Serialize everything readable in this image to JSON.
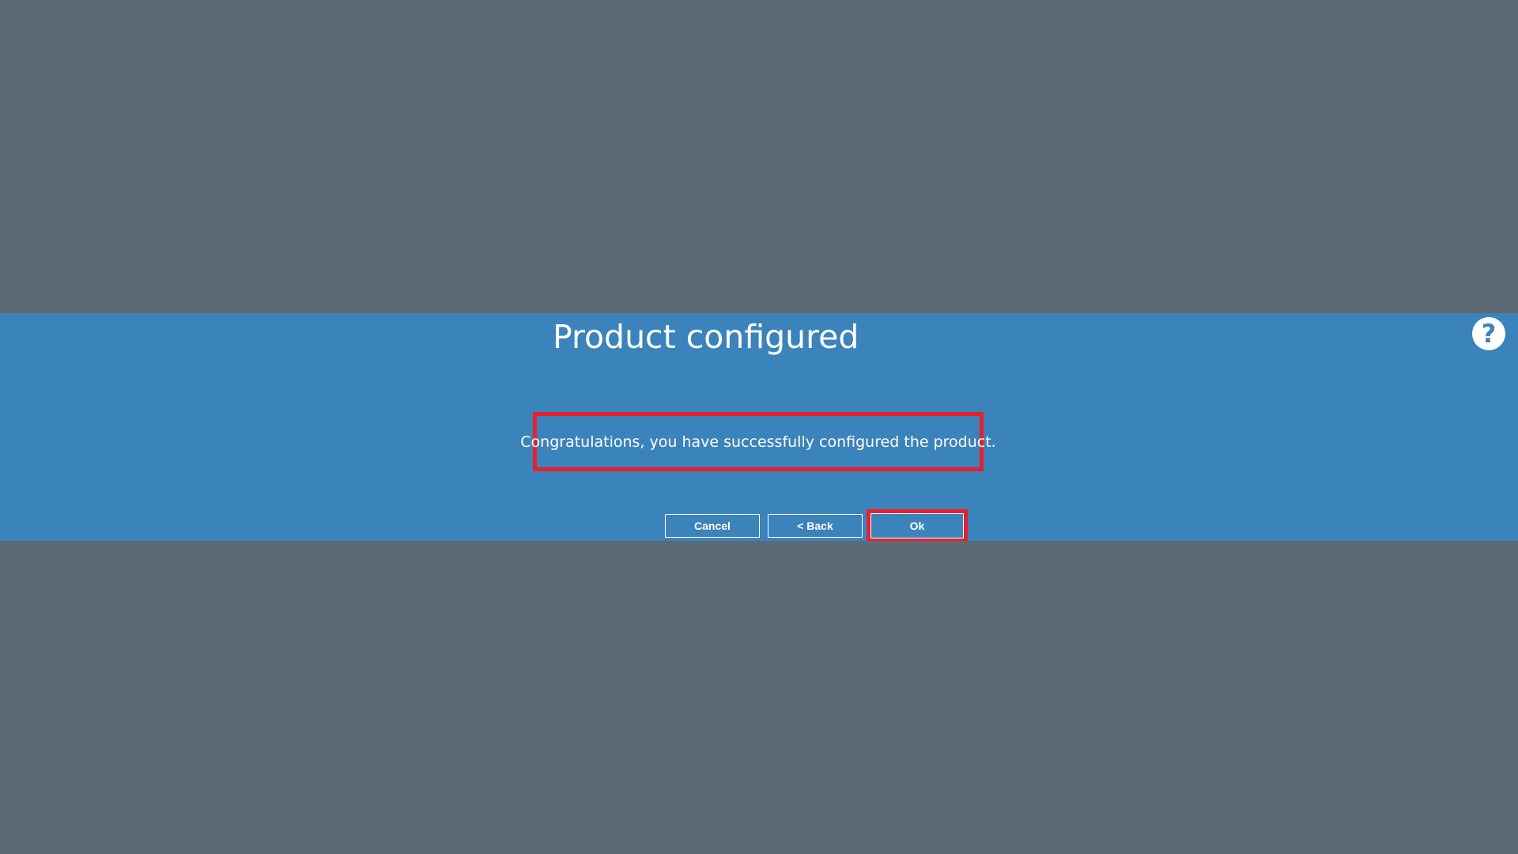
{
  "dialog": {
    "title": "Product configured",
    "message": "Congratulations, you have successfully configured the product.",
    "help_icon": "question-circle-icon",
    "help_glyph": "?"
  },
  "buttons": {
    "cancel_label": "Cancel",
    "back_label": "< Back",
    "ok_label": "Ok"
  },
  "colors": {
    "backdrop": "#5d6a75",
    "dialog_band": "#3b83bb",
    "highlight": "#e8202e",
    "text": "#ffffff"
  }
}
